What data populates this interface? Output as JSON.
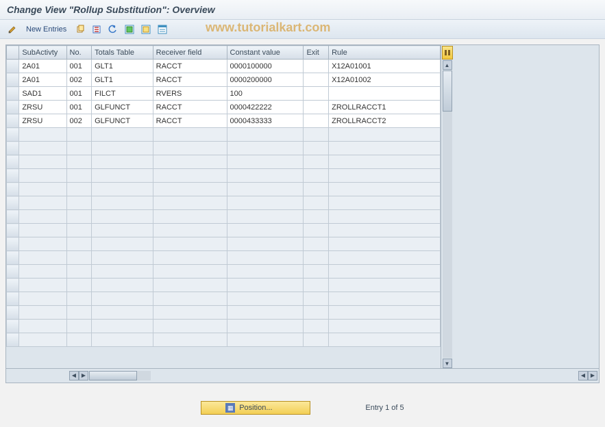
{
  "title": "Change View \"Rollup Substitution\": Overview",
  "watermark": "www.tutorialkart.com",
  "toolbar": {
    "new_entries": "New Entries"
  },
  "columns": {
    "sub": "SubActivty",
    "no": "No.",
    "tot": "Totals Table",
    "rec": "Receiver field",
    "con": "Constant value",
    "exit": "Exit",
    "rule": "Rule"
  },
  "rows": [
    {
      "sub": "2A01",
      "no": "001",
      "tot": "GLT1",
      "rec": "RACCT",
      "con": "0000100000",
      "exit": "",
      "rule": "X12A01001"
    },
    {
      "sub": "2A01",
      "no": "002",
      "tot": "GLT1",
      "rec": "RACCT",
      "con": "0000200000",
      "exit": "",
      "rule": "X12A01002"
    },
    {
      "sub": "SAD1",
      "no": "001",
      "tot": "FILCT",
      "rec": "RVERS",
      "con": "100",
      "exit": "",
      "rule": ""
    },
    {
      "sub": "ZRSU",
      "no": "001",
      "tot": "GLFUNCT",
      "rec": "RACCT",
      "con": "0000422222",
      "exit": "",
      "rule": "ZROLLRACCT1"
    },
    {
      "sub": "ZRSU",
      "no": "002",
      "tot": "GLFUNCT",
      "rec": "RACCT",
      "con": "0000433333",
      "exit": "",
      "rule": "ZROLLRACCT2"
    }
  ],
  "empty_rows": 16,
  "footer": {
    "position_btn": "Position...",
    "status": "Entry 1 of 5"
  }
}
